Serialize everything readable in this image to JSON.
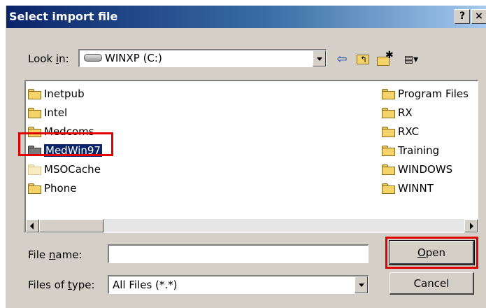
{
  "window": {
    "title": "Select import file",
    "help_button": "?",
    "close_button": "×"
  },
  "look_in": {
    "label_prefix": "Look ",
    "label_accel": "i",
    "label_suffix": "n:",
    "value": "WINXP (C:)"
  },
  "toolbar": {
    "back": "⇦",
    "up": "⮤",
    "new_folder": "✱",
    "views": "▤▾"
  },
  "folders_left": [
    "Inetpub",
    "Intel",
    "Medcoms",
    "MedWin97",
    "MSOCache",
    "Phone"
  ],
  "folders_right": [
    "Program Files",
    "RX",
    "RXC",
    "Training",
    "WINDOWS",
    "WINNT"
  ],
  "file_name": {
    "label_prefix": "File ",
    "label_accel": "n",
    "label_suffix": "ame:",
    "value": ""
  },
  "file_type": {
    "label_prefix": "Files of ",
    "label_accel": "t",
    "label_suffix": "ype:",
    "value": "All Files (*.*)"
  },
  "buttons": {
    "open_accel": "O",
    "open_rest": "pen",
    "cancel": "Cancel"
  }
}
